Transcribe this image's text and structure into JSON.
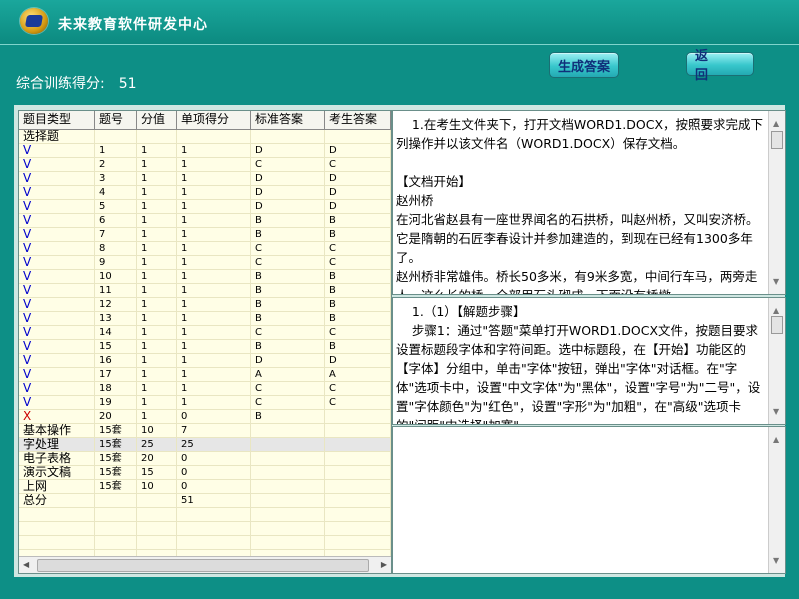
{
  "app": {
    "title": "未来教育软件研发中心",
    "score_label": "综合训练得分:",
    "score_value": "51",
    "generate_button": "生成答案",
    "back_button": "返 回"
  },
  "table": {
    "headers": [
      "题目类型",
      "题号",
      "分值",
      "单项得分",
      "标准答案",
      "考生答案"
    ],
    "rows": [
      [
        "选择题",
        "",
        "",
        "",
        "",
        ""
      ],
      [
        "V",
        "1",
        "1",
        "1",
        "D",
        "D"
      ],
      [
        "V",
        "2",
        "1",
        "1",
        "C",
        "C"
      ],
      [
        "V",
        "3",
        "1",
        "1",
        "D",
        "D"
      ],
      [
        "V",
        "4",
        "1",
        "1",
        "D",
        "D"
      ],
      [
        "V",
        "5",
        "1",
        "1",
        "D",
        "D"
      ],
      [
        "V",
        "6",
        "1",
        "1",
        "B",
        "B"
      ],
      [
        "V",
        "7",
        "1",
        "1",
        "B",
        "B"
      ],
      [
        "V",
        "8",
        "1",
        "1",
        "C",
        "C"
      ],
      [
        "V",
        "9",
        "1",
        "1",
        "C",
        "C"
      ],
      [
        "V",
        "10",
        "1",
        "1",
        "B",
        "B"
      ],
      [
        "V",
        "11",
        "1",
        "1",
        "B",
        "B"
      ],
      [
        "V",
        "12",
        "1",
        "1",
        "B",
        "B"
      ],
      [
        "V",
        "13",
        "1",
        "1",
        "B",
        "B"
      ],
      [
        "V",
        "14",
        "1",
        "1",
        "C",
        "C"
      ],
      [
        "V",
        "15",
        "1",
        "1",
        "B",
        "B"
      ],
      [
        "V",
        "16",
        "1",
        "1",
        "D",
        "D"
      ],
      [
        "V",
        "17",
        "1",
        "1",
        "A",
        "A"
      ],
      [
        "V",
        "18",
        "1",
        "1",
        "C",
        "C"
      ],
      [
        "V",
        "19",
        "1",
        "1",
        "C",
        "C"
      ],
      [
        "X",
        "20",
        "1",
        "0",
        "B",
        ""
      ],
      [
        "基本操作",
        "15套",
        "10",
        "7",
        "",
        ""
      ],
      [
        "字处理",
        "15套",
        "25",
        "25",
        "",
        ""
      ],
      [
        "电子表格",
        "15套",
        "20",
        "0",
        "",
        ""
      ],
      [
        "演示文稿",
        "15套",
        "15",
        "0",
        "",
        ""
      ],
      [
        "上网",
        "15套",
        "10",
        "0",
        "",
        ""
      ],
      [
        "总分",
        "",
        "",
        "51",
        "",
        ""
      ]
    ]
  },
  "doc_pane": {
    "text": "    1.在考生文件夹下，打开文档WORD1.DOCX，按照要求完成下列操作并以该文件名（WORD1.DOCX）保存文档。\n\n【文档开始】\n赵州桥\n在河北省赵县有一座世界闻名的石拱桥，叫赵州桥，又叫安济桥。它是隋朝的石匠李春设计并参加建造的，到现在已经有1300多年了。\n赵州桥非常雄伟。桥长50多米，有9米多宽，中间行车马，两旁走人。这么长的桥，全部用石头砌成，下面没有桥墩，"
  },
  "steps_pane": {
    "text": "    1.（1）【解题步骤】\n    步骤1：通过\"答题\"菜单打开WORD1.DOCX文件，按题目要求设置标题段字体和字符间距。选中标题段，在【开始】功能区的【字体】分组中，单击\"字体\"按钮，弹出\"字体\"对话框。在\"字体\"选项卡中，设置\"中文字体\"为\"黑体\"，设置\"字号\"为\"二号\"，设置\"字体颜色\"为\"红色\"，设置\"字形\"为\"加粗\"，在\"高级\"选项卡的\"间距\"中选择\"加宽\"，"
  }
}
